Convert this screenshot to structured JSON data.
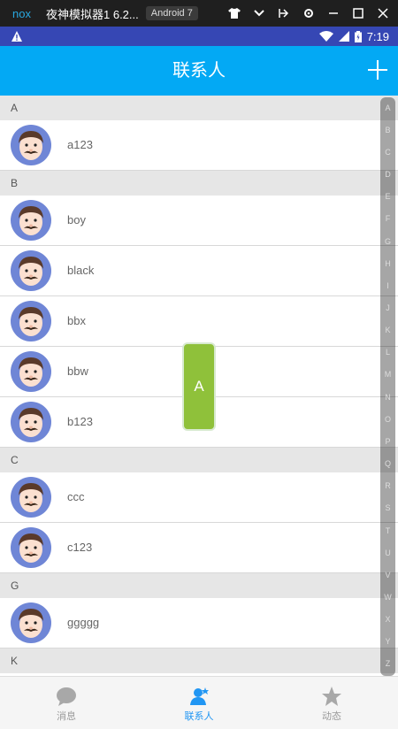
{
  "emulator": {
    "logo": "nox",
    "title": "夜神模拟器1 6.2...",
    "version": "Android 7",
    "icons": [
      "shirt-icon",
      "chevron-down-icon",
      "pin-icon",
      "gear-icon",
      "minimize-icon",
      "maximize-icon",
      "close-icon"
    ]
  },
  "status_bar": {
    "time": "7:19"
  },
  "header": {
    "title": "联系人"
  },
  "sections": [
    {
      "letter": "A",
      "contacts": [
        "a123"
      ]
    },
    {
      "letter": "B",
      "contacts": [
        "boy",
        "black",
        "bbx",
        "bbw",
        "b123"
      ]
    },
    {
      "letter": "C",
      "contacts": [
        "ccc",
        "c123"
      ]
    },
    {
      "letter": "G",
      "contacts": [
        "ggggg"
      ]
    },
    {
      "letter": "K",
      "contacts": []
    }
  ],
  "index_letters": [
    "A",
    "B",
    "C",
    "D",
    "E",
    "F",
    "G",
    "H",
    "I",
    "J",
    "K",
    "L",
    "M",
    "N",
    "O",
    "P",
    "Q",
    "R",
    "S",
    "T",
    "U",
    "V",
    "W",
    "X",
    "Y",
    "Z"
  ],
  "overlay_letter": "A",
  "nav": {
    "items": [
      {
        "label": "消息",
        "icon": "chat-bubble-icon",
        "active": false
      },
      {
        "label": "联系人",
        "icon": "contacts-icon",
        "active": true
      },
      {
        "label": "动态",
        "icon": "star-icon",
        "active": false
      }
    ]
  },
  "colors": {
    "header": "#03a9f4",
    "status_bar": "#3647b4",
    "overlay": "#8fc13a",
    "nav_active": "#2196f3"
  }
}
